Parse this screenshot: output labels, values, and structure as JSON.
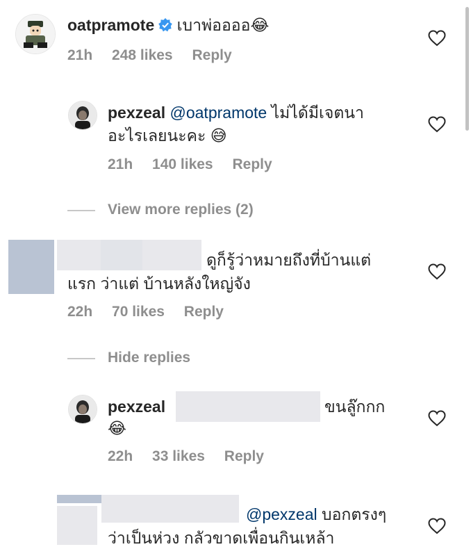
{
  "comments": [
    {
      "username": "oatpramote",
      "verified": true,
      "text": "เบาพ่ออออ",
      "emoji": "😂",
      "time": "21h",
      "likes": "248 likes",
      "reply_label": "Reply"
    },
    {
      "username": "pexzeal",
      "mention": "@oatpramote",
      "text_line1": "ไม่ได้มีเจตนา",
      "text_line2": "อะไรเลยนะคะ",
      "emoji": "😅",
      "time": "21h",
      "likes": "140 likes",
      "reply_label": "Reply"
    },
    {
      "text_line1": "ดูก็รู้ว่าหมายถึงที่บ้านแต่",
      "text_line2": "แรก ว่าแต่ บ้านหลังใหญ่จัง",
      "time": "22h",
      "likes": "70 likes",
      "reply_label": "Reply"
    },
    {
      "username": "pexzeal",
      "text": "ขนลู๊กกก",
      "emoji": "😂",
      "time": "22h",
      "likes": "33 likes",
      "reply_label": "Reply"
    },
    {
      "mention": "@pexzeal",
      "text_line1": "บอกตรงๆ",
      "text_line2": "ว่าเป็นห่วง กลัวขาดเพื่อนกินเหล้า"
    }
  ],
  "threads": {
    "view_more": "View more replies (2)",
    "hide": "Hide replies"
  },
  "icons": {
    "like": "heart-icon",
    "verified": "verified-badge-icon"
  },
  "colors": {
    "text": "#262626",
    "secondary": "#8e8e8e",
    "mention": "#00376b",
    "verified": "#3897f0"
  }
}
